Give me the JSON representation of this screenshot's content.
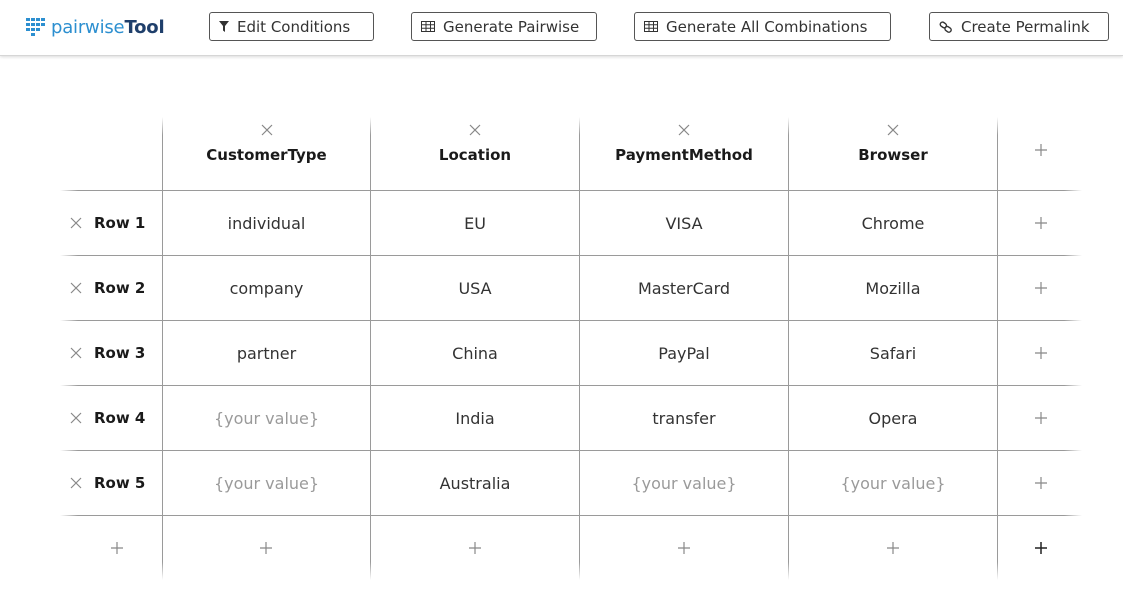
{
  "app": {
    "logo_part1": "pairwise",
    "logo_part2": "Tool"
  },
  "toolbar": {
    "edit_conditions": "Edit Conditions",
    "generate_pairwise": "Generate Pairwise",
    "generate_all": "Generate All Combinations",
    "create_permalink": "Create Permalink"
  },
  "columns": [
    "CustomerType",
    "Location",
    "PaymentMethod",
    "Browser"
  ],
  "rows": [
    {
      "label": "Row 1",
      "cells": [
        "individual",
        "EU",
        "VISA",
        "Chrome"
      ]
    },
    {
      "label": "Row 2",
      "cells": [
        "company",
        "USA",
        "MasterCard",
        "Mozilla"
      ]
    },
    {
      "label": "Row 3",
      "cells": [
        "partner",
        "China",
        "PayPal",
        "Safari"
      ]
    },
    {
      "label": "Row 4",
      "cells": [
        "",
        "India",
        "transfer",
        "Opera"
      ]
    },
    {
      "label": "Row 5",
      "cells": [
        "",
        "Australia",
        "",
        ""
      ]
    }
  ],
  "placeholder": "{your value}",
  "icons": {
    "remove": "close-icon",
    "add": "plus-icon",
    "filter": "filter-icon",
    "table": "table-icon",
    "link": "link-icon"
  }
}
